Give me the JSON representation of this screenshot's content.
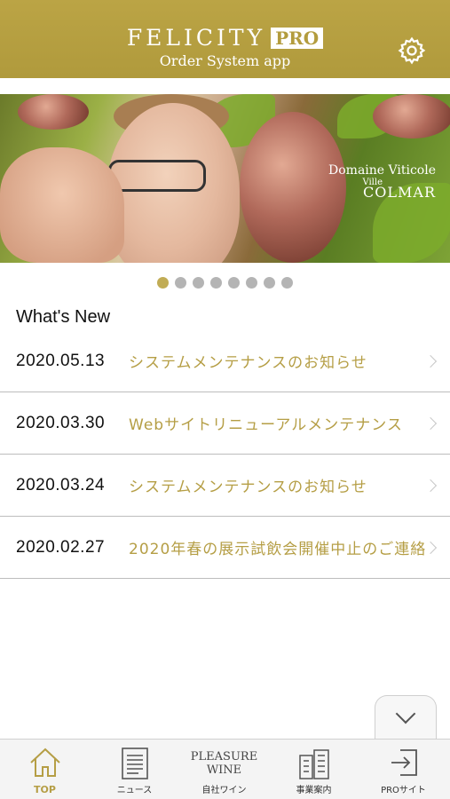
{
  "header": {
    "brand_name": "FELICITY",
    "brand_badge": "PRO",
    "subtitle": "Order System app",
    "settings_icon": "gear-icon"
  },
  "banner": {
    "overlay_line1": "Domaine Viticole",
    "overlay_line2": "Ville",
    "overlay_line3": "COLMAR",
    "page_count": 8,
    "active_page": 1
  },
  "news": {
    "title": "What's New",
    "items": [
      {
        "date": "2020.05.13",
        "title": "システムメンテナンスのお知らせ"
      },
      {
        "date": "2020.03.30",
        "title": "Webサイトリニューアルメンテナンス"
      },
      {
        "date": "2020.03.24",
        "title": "システムメンテナンスのお知らせ"
      },
      {
        "date": "2020.02.27",
        "title": "2020年春の展示試飲会開催中止のご連絡"
      }
    ]
  },
  "colors": {
    "accent": "#b59e45",
    "header": "#b8a040"
  },
  "tabbar": {
    "items": [
      {
        "label": "TOP",
        "icon": "home-icon",
        "active": true
      },
      {
        "label": "ニュース",
        "icon": "document-icon"
      },
      {
        "label": "自社ワイン",
        "icon": "pleasure-wine-logo",
        "logo_line1": "PLEASURE",
        "logo_line2": "WINE"
      },
      {
        "label": "事業案内",
        "icon": "building-icon"
      },
      {
        "label": "PROサイト",
        "icon": "login-icon"
      }
    ]
  }
}
